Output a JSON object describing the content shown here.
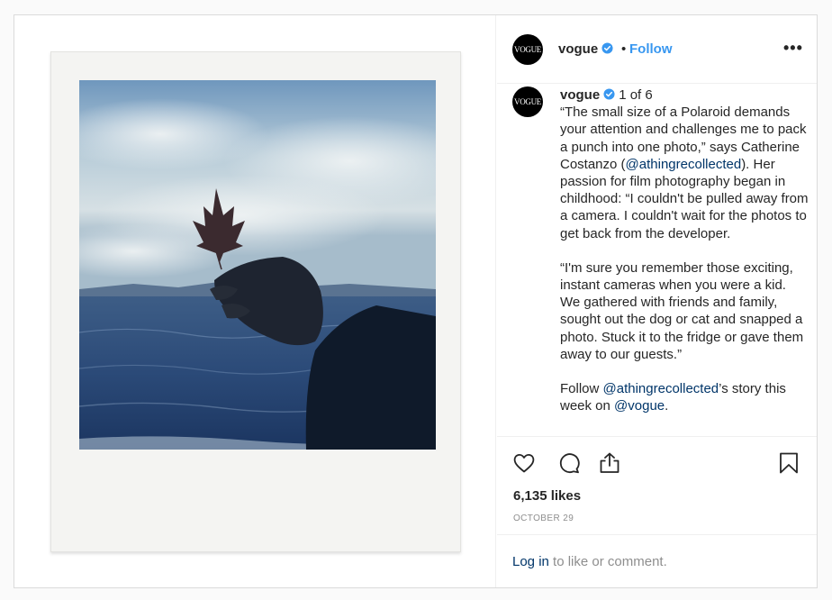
{
  "post": {
    "username": "vogue",
    "avatar_text": "VOGUE",
    "follow_label": "Follow",
    "separator": "•",
    "more_label": "•••"
  },
  "caption": {
    "username": "vogue",
    "counter": "1 of 6",
    "p1_a": "“The small size of a Polaroid demands your attention and challenges me to pack a punch into one photo,” says Catherine Costanzo (",
    "p1_mention": "@athingrecollected",
    "p1_b": "). Her passion for film photography began in childhood: “I couldn't be pulled away from a camera. I couldn't wait for the photos to get back from the developer.",
    "p2": "“I'm sure you remember those exciting, instant cameras when you were a kid. We gathered with friends and family, sought out the dog or cat and snapped a photo. Stuck it to the fridge or gave them away to our guests.”",
    "p3_a": "Follow ",
    "p3_mention1": "@athingrecollected",
    "p3_b": "’s story this week on ",
    "p3_mention2": "@vogue",
    "p3_c": "."
  },
  "actions": {
    "like_icon": "heart-icon",
    "comment_icon": "comment-icon",
    "share_icon": "share-icon",
    "save_icon": "bookmark-icon"
  },
  "likes": "6,135 likes",
  "date": "OCTOBER 29",
  "login": {
    "link": "Log in",
    "rest": " to like or comment."
  },
  "colors": {
    "accent": "#3897f0",
    "link": "#003569",
    "verified": "#3897f0",
    "muted": "#8e8e8e"
  }
}
